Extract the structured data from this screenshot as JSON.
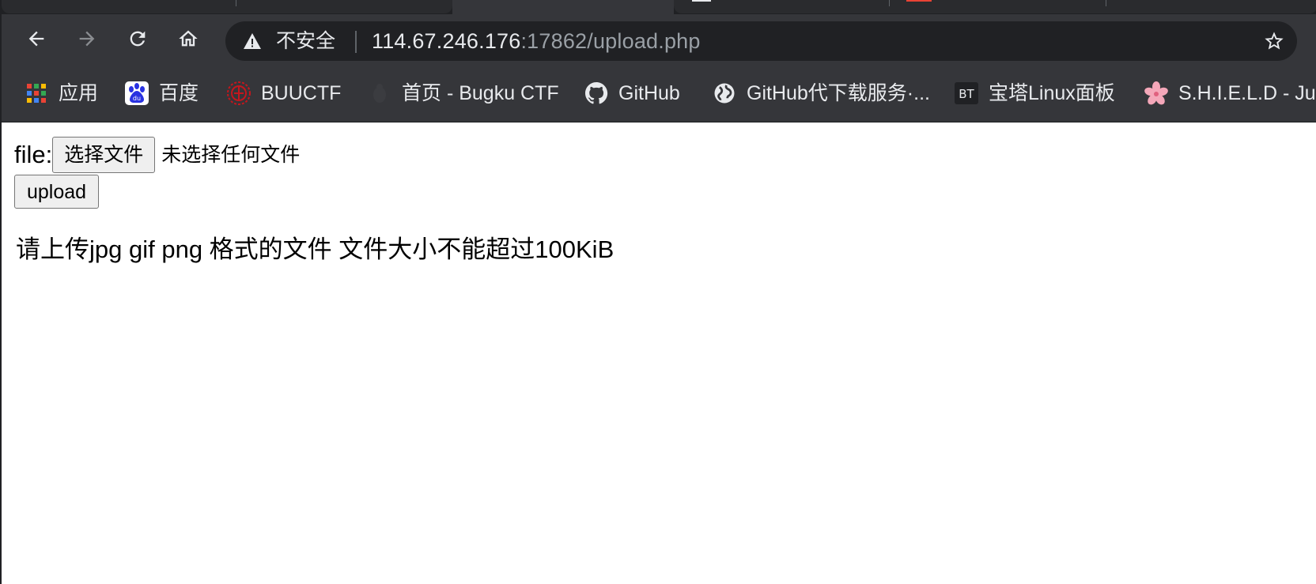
{
  "colors": {
    "chrome_dark": "#202124",
    "toolbar": "#35363a",
    "text_light": "#e8eaed",
    "text_muted": "#9aa0a6",
    "page_bg": "#ffffff",
    "button_bg": "#efefef",
    "button_border": "#767676"
  },
  "toolbar": {
    "back_icon": "arrow-left",
    "forward_icon": "arrow-right",
    "reload_icon": "reload",
    "home_icon": "home",
    "security_icon": "warning-triangle",
    "security_label": "不安全",
    "url_host": "114.67.246.176",
    "url_rest": ":17862/upload.php",
    "star_icon": "star-outline"
  },
  "bookmarks": [
    {
      "label": "应用",
      "icon": "apps-grid"
    },
    {
      "label": "百度",
      "icon": "baidu-paw"
    },
    {
      "label": "BUUCTF",
      "icon": "buuctf-logo"
    },
    {
      "label": "首页 - Bugku CTF",
      "icon": "bugku-logo"
    },
    {
      "label": "GitHub",
      "icon": "github-logo"
    },
    {
      "label": "GitHub代下载服务·...",
      "icon": "globe"
    },
    {
      "label": "宝塔Linux面板",
      "icon": "bt-logo",
      "icon_text": "BT"
    },
    {
      "label": "S.H.I.E.L.D - Jus",
      "icon": "sakura-flower"
    }
  ],
  "form": {
    "file_label": "file:",
    "choose_button": "选择文件",
    "no_file_text": "未选择任何文件",
    "upload_button": "upload"
  },
  "notice": "请上传jpg gif png 格式的文件 文件大小不能超过100KiB"
}
